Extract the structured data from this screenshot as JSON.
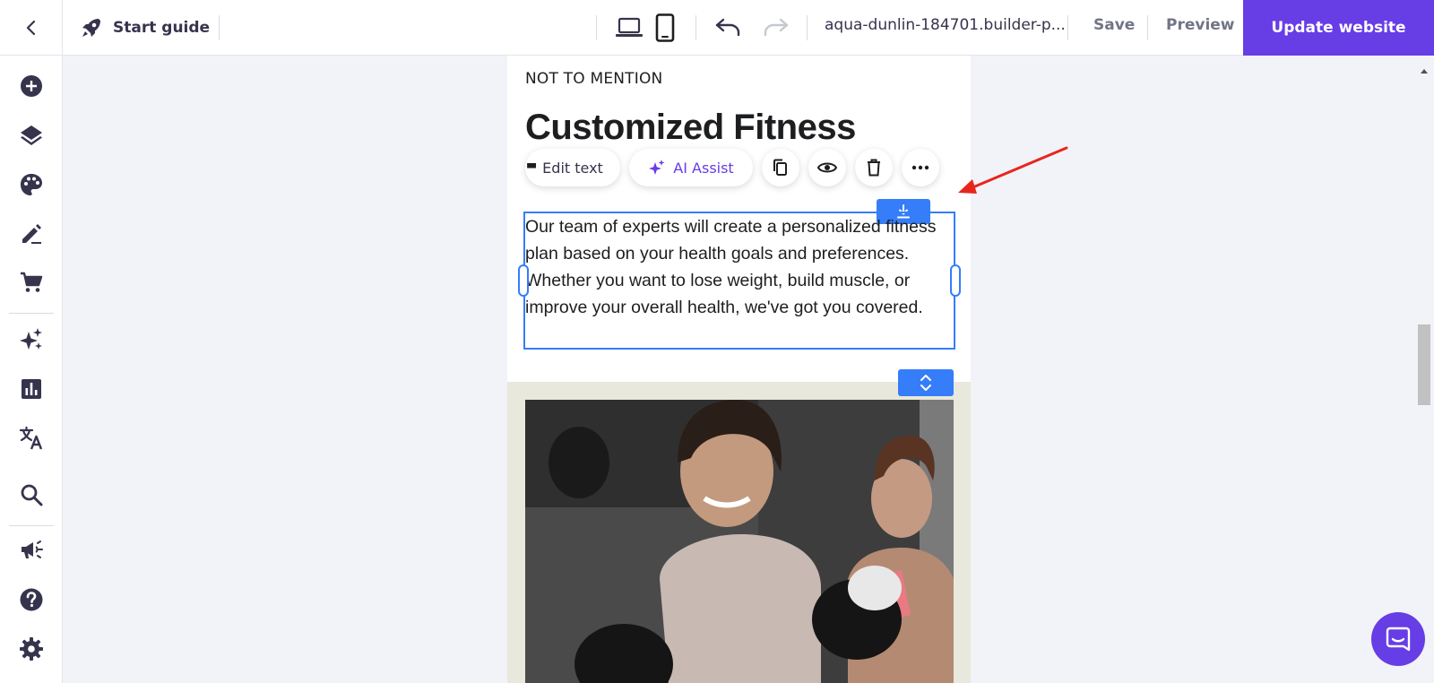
{
  "topbar": {
    "start_guide_label": "Start guide",
    "url": "aqua-dunlin-184701.builder-p...",
    "save_label": "Save",
    "preview_label": "Preview",
    "update_label": "Update website"
  },
  "sidebar": {
    "items": [
      {
        "icon": "add-icon"
      },
      {
        "icon": "layers-icon"
      },
      {
        "icon": "palette-icon"
      },
      {
        "icon": "edit-pen-icon"
      },
      {
        "icon": "cart-icon"
      },
      {
        "icon": "ai-sparkle-icon"
      },
      {
        "icon": "analytics-icon"
      },
      {
        "icon": "translate-icon"
      },
      {
        "icon": "search-icon"
      },
      {
        "icon": "megaphone-icon"
      },
      {
        "icon": "help-icon"
      },
      {
        "icon": "settings-icon"
      }
    ]
  },
  "page": {
    "kicker": "NOT TO MENTION",
    "heading": "Customized Fitness",
    "paragraph": "Our team of experts will create a personalized fitness plan based on your health goals and preferences. Whether you want to lose weight, build muscle, or improve your overall health, we've got you covered."
  },
  "toolbar": {
    "edit_text_label": "Edit text",
    "ai_assist_label": "AI Assist"
  },
  "colors": {
    "accent": "#673de6",
    "selection": "#357df9",
    "annotation_arrow": "#e8261c",
    "section_bg": "#e9e8dc"
  }
}
